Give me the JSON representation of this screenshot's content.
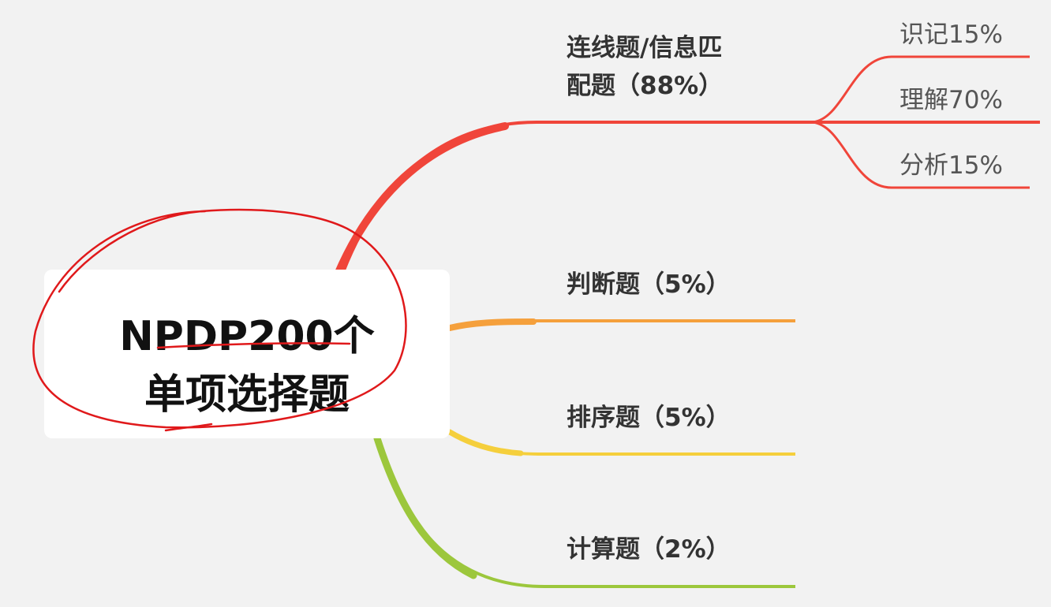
{
  "root": {
    "line1": "NPDP200个",
    "line2": "单项选择题"
  },
  "branches": [
    {
      "label_line1": "连线题/信息匹",
      "label_line2": "配题（88%）",
      "color": "#f0453a"
    },
    {
      "label": "判断题（5%）",
      "color": "#f5a03c"
    },
    {
      "label": "排序题（5%）",
      "color": "#f5cf3c"
    },
    {
      "label": "计算题（2%）",
      "color": "#9cc73c"
    }
  ],
  "leaves": [
    {
      "label": "识记15%"
    },
    {
      "label": "理解70%"
    },
    {
      "label": "分析15%"
    }
  ],
  "annotation": {
    "color": "#e0191b"
  }
}
